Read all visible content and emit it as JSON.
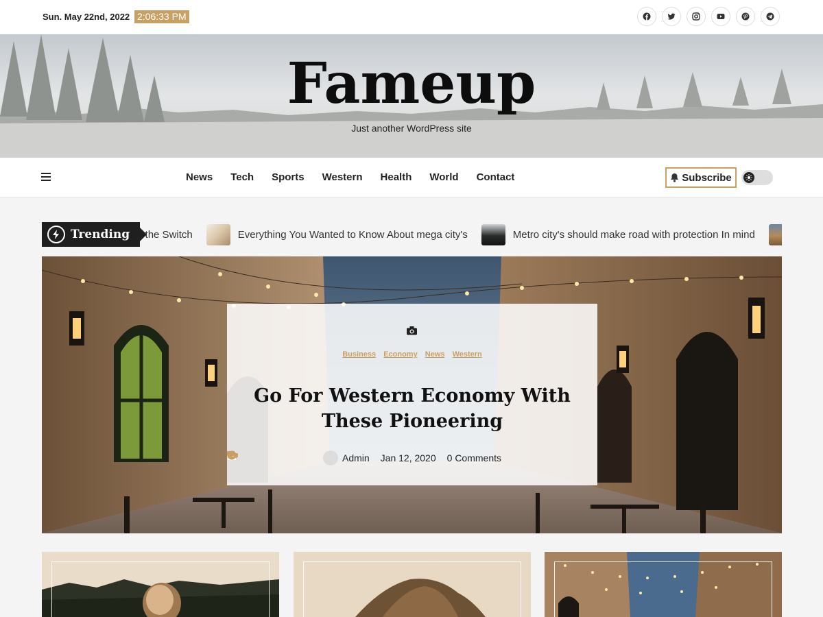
{
  "topbar": {
    "date": "Sun. May 22nd, 2022",
    "time": "2:06:33 PM",
    "social_icons": [
      "facebook-icon",
      "twitter-icon",
      "instagram-icon",
      "youtube-icon",
      "pinterest-icon",
      "telegram-icon"
    ]
  },
  "header": {
    "site_title": "Fameup",
    "tagline": "Just another WordPress site"
  },
  "nav": {
    "items": [
      "News",
      "Tech",
      "Sports",
      "Western",
      "Health",
      "World",
      "Contact"
    ],
    "subscribe_label": "Subscribe"
  },
  "trending": {
    "label": "Trending",
    "items": [
      "n't the Switch",
      "Everything You Wanted to Know About mega city's",
      "Metro city's should make road with protection In mind"
    ]
  },
  "hero": {
    "categories": [
      "Business",
      "Economy",
      "News",
      "Western"
    ],
    "title": "Go For Western Economy With These Pioneering",
    "author": "Admin",
    "date": "Jan 12, 2020",
    "comments": "0 Comments"
  },
  "colors": {
    "accent": "#c9a063",
    "dark": "#1f1f1f",
    "background": "#f4f4f4"
  }
}
